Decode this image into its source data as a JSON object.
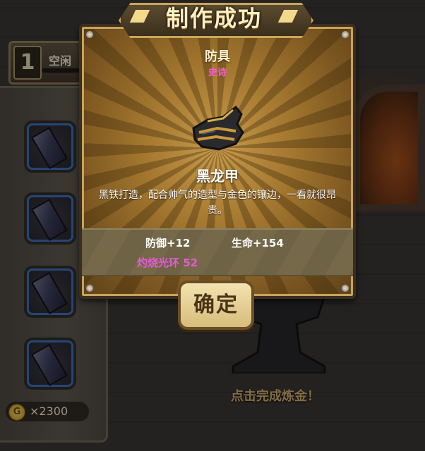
{
  "title": "制作成功",
  "level": {
    "number": "1",
    "label": "空闲"
  },
  "item": {
    "type": "防具",
    "rarity": "史诗",
    "name": "黑龙甲",
    "description": "黑铁打造，配合帅气的造型与金色的镶边，一看就很昂贵。",
    "icon": "armor-gauntlet-icon"
  },
  "stats": {
    "defense": "防御+12",
    "life": "生命+154",
    "special": "灼烧光环 52"
  },
  "confirm_label": "确定",
  "coins": {
    "icon": "gold-coin-icon",
    "symbol": "G",
    "amount": "×2300"
  },
  "hint": "点击完成炼金！",
  "slots": [
    {
      "icon": "iron-ingot-icon"
    },
    {
      "icon": "iron-ingot-icon"
    },
    {
      "icon": "iron-ingot-icon"
    },
    {
      "icon": "iron-ingot-icon"
    }
  ],
  "colors": {
    "rarity": "#ff5ad6",
    "special_stat": "#e45bd6",
    "slot_border": "#3d6bb4"
  }
}
